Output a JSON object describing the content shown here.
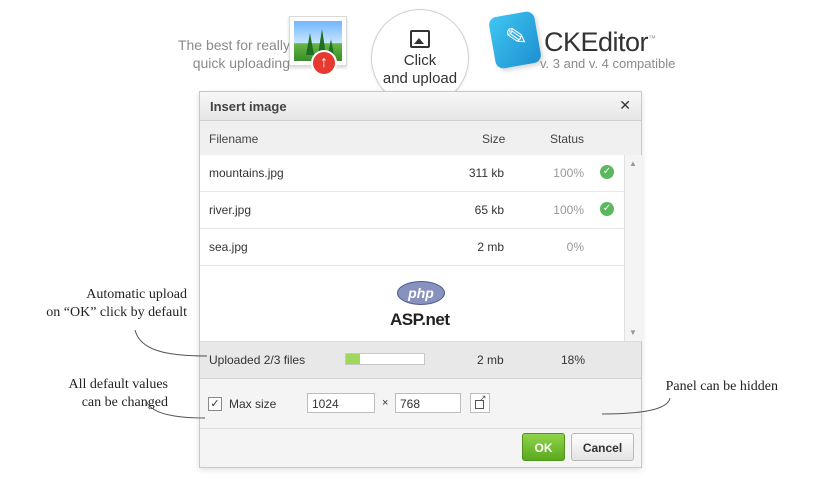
{
  "promo": {
    "tagline_line1": "The best for really",
    "tagline_line2": "quick uploading",
    "circle_line1": "Click",
    "circle_line2": "and upload",
    "brand_name": "CKEditor",
    "brand_tm": "™",
    "brand_sub": "v. 3 and v. 4 compatible"
  },
  "dialog": {
    "title": "Insert image",
    "close_symbol": "✕",
    "columns": {
      "filename": "Filename",
      "size": "Size",
      "status": "Status"
    },
    "files": [
      {
        "name": "mountains.jpg",
        "size": "311 kb",
        "status": "100%",
        "done": true
      },
      {
        "name": "river.jpg",
        "size": "65 kb",
        "status": "100%",
        "done": true
      },
      {
        "name": "sea.jpg",
        "size": "2 mb",
        "status": "0%",
        "done": false
      }
    ],
    "logos": {
      "php": "php",
      "asp": "ASP.net"
    },
    "summary": {
      "label": "Uploaded  2/3 files",
      "progress": 0.18,
      "size": "2 mb",
      "percent": "18%"
    },
    "options": {
      "max_size_label": "Max size",
      "max_size_checked": true,
      "width": "1024",
      "height": "768",
      "times": "×"
    },
    "buttons": {
      "ok": "OK",
      "cancel": "Cancel"
    }
  },
  "annotations": {
    "auto_upload_line1": "Automatic upload",
    "auto_upload_line2": "on “OK” click by default",
    "defaults_line1": "All default values",
    "defaults_line2": "can be changed",
    "panel_hidden": "Panel can be hidden"
  },
  "colors": {
    "ok_green": "#5aa91e",
    "progress_fill": "#9ed95c",
    "status_ok": "#5cb85c"
  }
}
